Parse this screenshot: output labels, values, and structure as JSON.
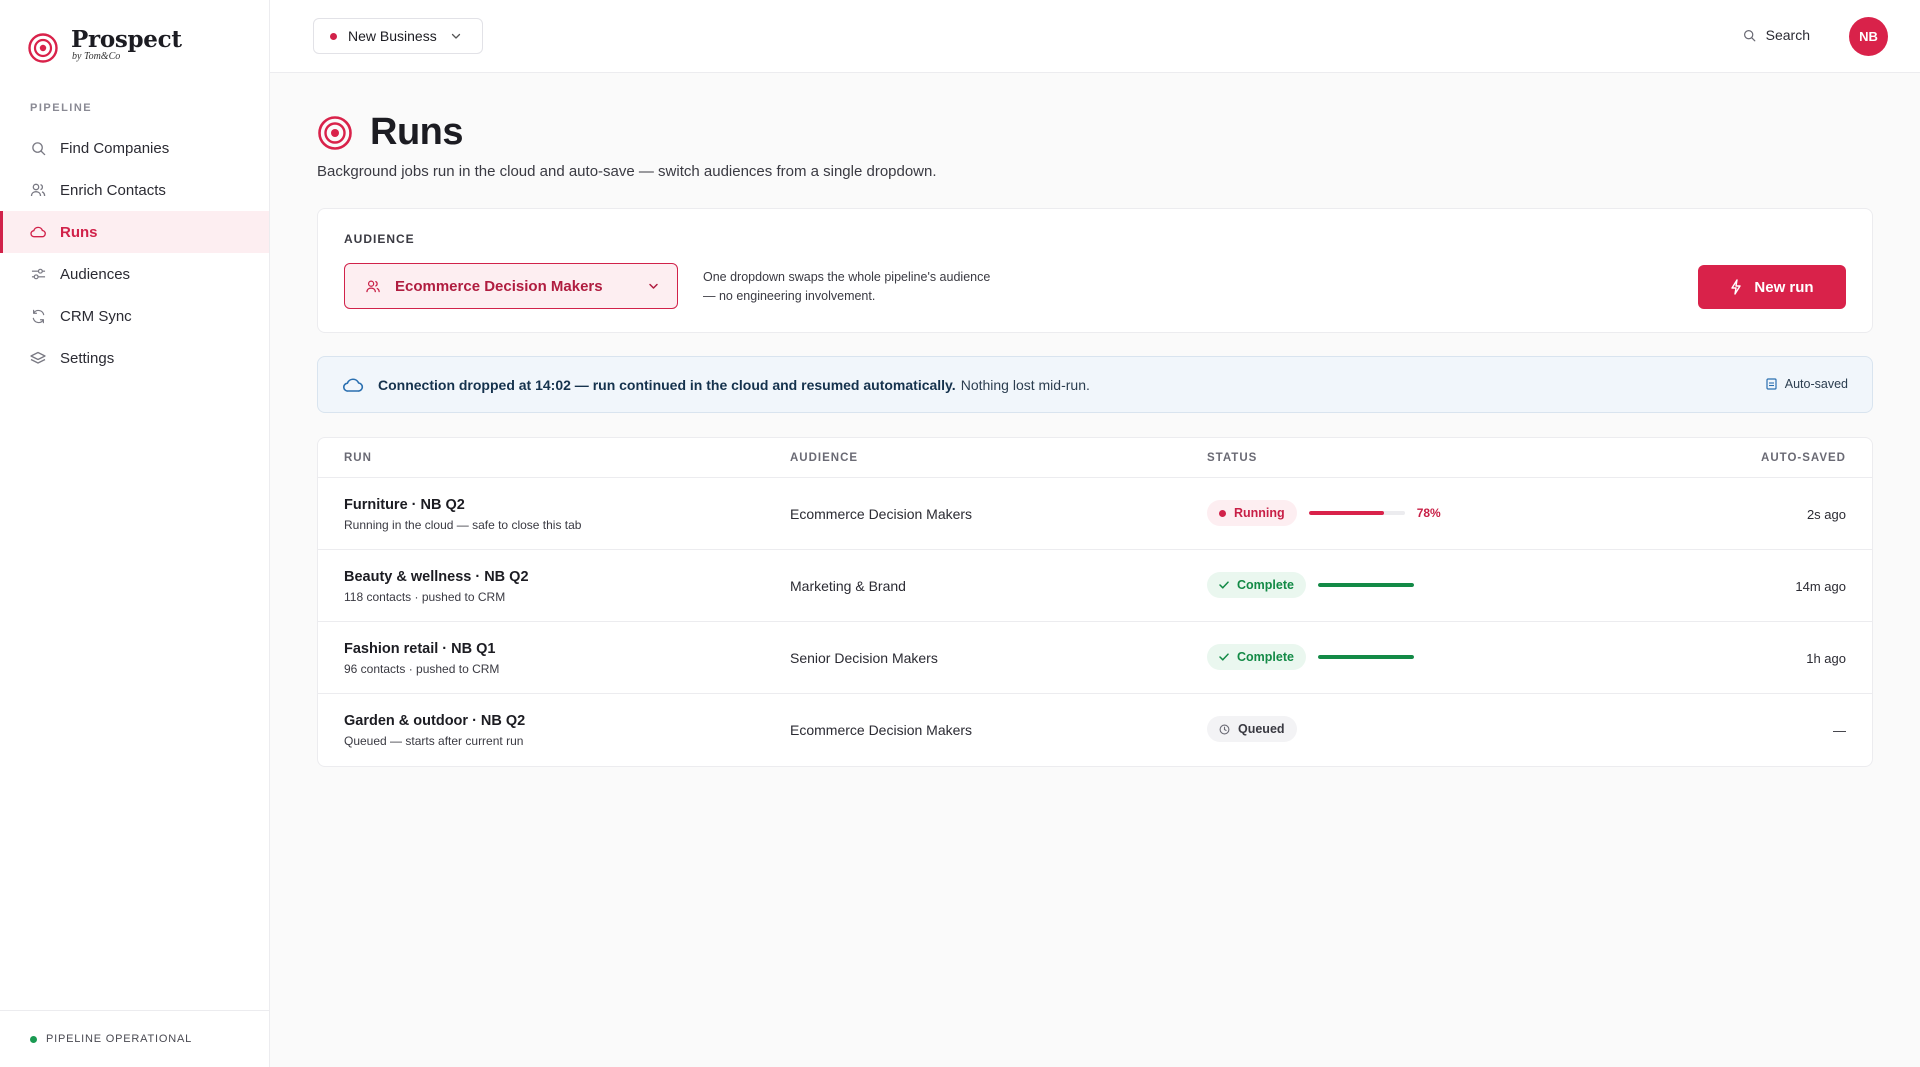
{
  "brand": {
    "name": "Prospect",
    "by": "by Tom&Co"
  },
  "sidebar": {
    "section": "PIPELINE",
    "items": [
      {
        "label": "Find Companies",
        "icon": "search-icon"
      },
      {
        "label": "Enrich Contacts",
        "icon": "users-icon"
      },
      {
        "label": "Runs",
        "icon": "cloud-icon",
        "active": true
      },
      {
        "label": "Audiences",
        "icon": "sliders-icon"
      },
      {
        "label": "CRM Sync",
        "icon": "sync-icon"
      },
      {
        "label": "Settings",
        "icon": "layers-icon"
      }
    ],
    "footer": "PIPELINE OPERATIONAL"
  },
  "topbar": {
    "workspace": "New Business",
    "search_label": "Search",
    "avatar_initials": "NB"
  },
  "page": {
    "title": "Runs",
    "subtitle": "Background jobs run in the cloud and auto-save — switch audiences from a single dropdown."
  },
  "audience": {
    "label": "AUDIENCE",
    "selected": "Ecommerce Decision Makers",
    "help_line1": "One dropdown swaps the whole pipeline's audience",
    "help_line2": "— no engineering involvement.",
    "new_run_label": "New run"
  },
  "banner": {
    "bold": "Connection dropped at 14:02 — run continued in the cloud and resumed automatically.",
    "rest": "Nothing lost mid-run.",
    "autosaved": "Auto-saved"
  },
  "table": {
    "headers": {
      "run": "RUN",
      "audience": "AUDIENCE",
      "status": "STATUS",
      "saved": "AUTO-SAVED"
    },
    "rows": [
      {
        "name": "Furniture · NB Q2",
        "sub": "Running in the cloud — safe to close this tab",
        "audience": "Ecommerce Decision Makers",
        "status": "Running",
        "progress": 0.78,
        "pct": "78%",
        "saved": "2s ago"
      },
      {
        "name": "Beauty & wellness · NB Q2",
        "sub": "118 contacts · pushed to CRM",
        "audience": "Marketing & Brand",
        "status": "Complete",
        "progress": 1.0,
        "saved": "14m ago"
      },
      {
        "name": "Fashion retail · NB Q1",
        "sub": "96 contacts · pushed to CRM",
        "audience": "Senior Decision Makers",
        "status": "Complete",
        "progress": 1.0,
        "saved": "1h ago"
      },
      {
        "name": "Garden & outdoor · NB Q2",
        "sub": "Queued — starts after current run",
        "audience": "Ecommerce Decision Makers",
        "status": "Queued",
        "saved": "—"
      }
    ]
  },
  "colors": {
    "accent": "#d9224a",
    "success": "#138a46",
    "info_bg": "#f1f6fb"
  }
}
